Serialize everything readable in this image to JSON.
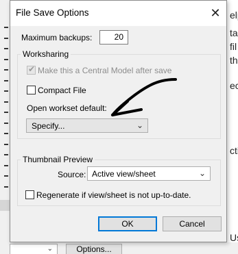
{
  "dialog": {
    "title": "File Save Options",
    "max_backups_label": "Maximum backups:",
    "max_backups_value": "20",
    "worksharing": {
      "group_title": "Worksharing",
      "central_model_label": "Make this a Central Model after save",
      "central_model_checked": true,
      "compact_file_label": "Compact File",
      "compact_file_checked": false,
      "open_workset_label": "Open workset default:",
      "open_workset_value": "Specify..."
    },
    "thumbnail": {
      "group_title": "Thumbnail Preview",
      "source_label": "Source:",
      "source_value": "Active view/sheet",
      "regenerate_label": "Regenerate if view/sheet is not up-to-date.",
      "regenerate_checked": false
    },
    "ok_label": "OK",
    "cancel_label": "Cancel"
  },
  "background": {
    "right_fragments": [
      "elp",
      "tai",
      "fil",
      "th",
      "ect",
      "ctio",
      "Us"
    ],
    "options_button_label": "Options..."
  },
  "colors": {
    "accent": "#0078d7",
    "dialog_bg": "#f0f0f0",
    "titlebar_bg": "#ffffff"
  }
}
